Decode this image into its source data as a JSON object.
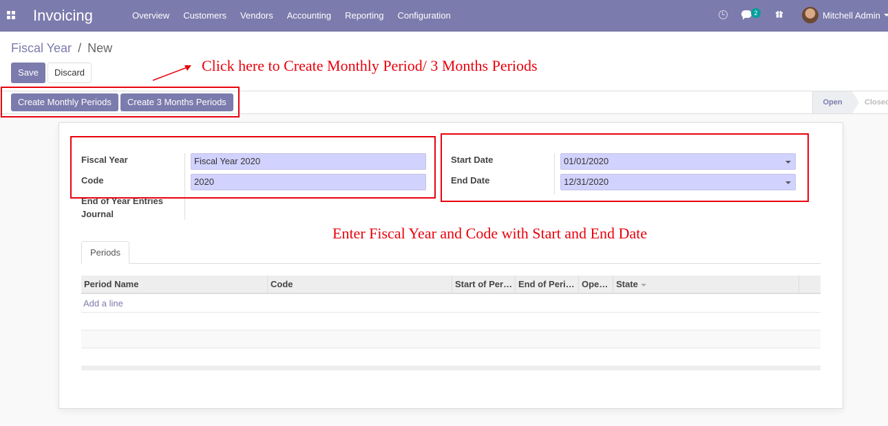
{
  "navbar": {
    "app_title": "Invoicing",
    "menu": [
      "Overview",
      "Customers",
      "Vendors",
      "Accounting",
      "Reporting",
      "Configuration"
    ],
    "chat_count": "2",
    "user_name": "Mitchell Admin",
    "icons": [
      "apps-icon",
      "clock-icon",
      "chat-icon",
      "gift-icon"
    ]
  },
  "breadcrumb": {
    "parent": "Fiscal Year",
    "separator": "/",
    "current": "New"
  },
  "buttons": {
    "save": "Save",
    "discard": "Discard"
  },
  "header_buttons": {
    "monthly": "Create Monthly Periods",
    "three_months": "Create 3 Months Periods"
  },
  "statusbar": {
    "open": "Open",
    "closed": "Closed"
  },
  "annotations": {
    "top": "Click here to Create Monthly Period/ 3 Months Periods",
    "middle": "Enter Fiscal Year and Code with Start and End Date"
  },
  "form": {
    "fiscal_year_label": "Fiscal Year",
    "fiscal_year_value": "Fiscal Year 2020",
    "code_label": "Code",
    "code_value": "2020",
    "end_year_label_1": "End of Year Entries",
    "end_year_label_2": "Journal",
    "start_date_label": "Start Date",
    "start_date_value": "01/01/2020",
    "end_date_label": "End Date",
    "end_date_value": "12/31/2020"
  },
  "tabs": {
    "periods": "Periods"
  },
  "table": {
    "columns": [
      "Period Name",
      "Code",
      "Start of Per…",
      "End of Peri…",
      "Ope…",
      "State"
    ],
    "add_line": "Add a line"
  },
  "colors": {
    "brand": "#7c7bad",
    "annotation": "#e8000b",
    "input_bg": "#d2d2ff",
    "badge": "#00a09d"
  }
}
